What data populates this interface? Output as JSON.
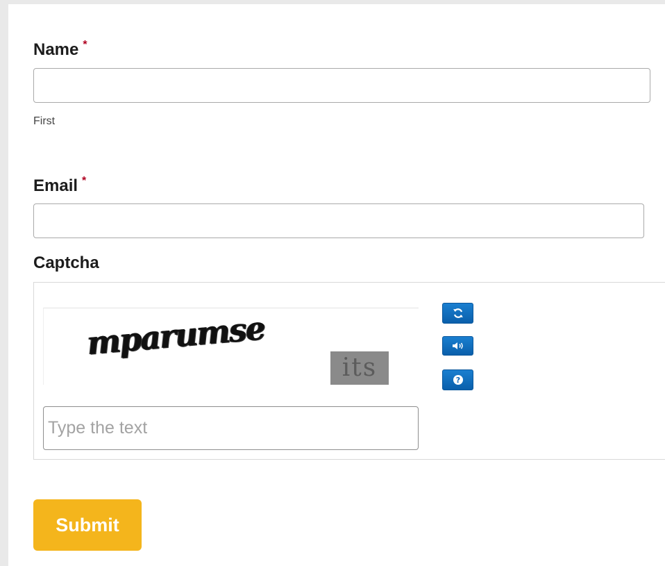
{
  "form": {
    "name": {
      "label": "Name",
      "required_mark": "*",
      "sublabel": "First",
      "value": ""
    },
    "email": {
      "label": "Email",
      "required_mark": "*",
      "value": ""
    },
    "captcha": {
      "label": "Captcha",
      "challenge_text": "mparumse",
      "noise_text": "its",
      "input_placeholder": "Type the text",
      "buttons": [
        {
          "icon": "refresh-icon"
        },
        {
          "icon": "audio-icon"
        },
        {
          "icon": "help-icon"
        }
      ],
      "button_color": "#0b66b8"
    },
    "submit": {
      "label": "Submit",
      "color": "#f4b51c"
    }
  }
}
